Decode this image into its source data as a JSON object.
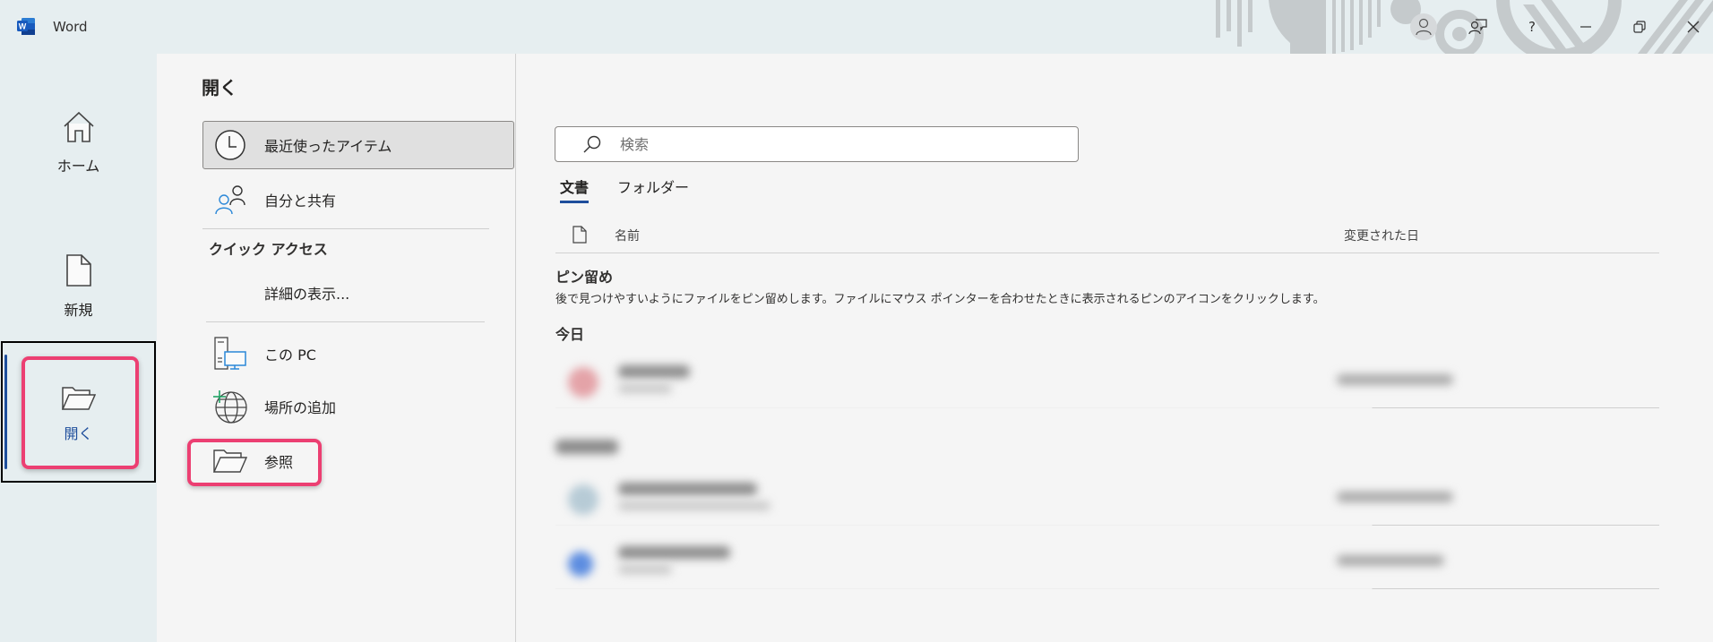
{
  "window": {
    "app_title": "Word",
    "controls": {
      "account": "account-icon",
      "feedback": "feedback-icon",
      "help": "?",
      "minimize": "minimize-icon",
      "restore": "restore-icon",
      "close": "close-icon"
    }
  },
  "leftnav": {
    "items": [
      {
        "label": "ホーム",
        "icon": "home-icon"
      },
      {
        "label": "新規",
        "icon": "new-document-icon"
      },
      {
        "label": "開く",
        "icon": "open-folder-icon",
        "active": true
      }
    ]
  },
  "open_page": {
    "title": "開く",
    "places": [
      {
        "label": "最近使ったアイテム",
        "icon": "clock-icon",
        "selected": true
      },
      {
        "label": "自分と共有",
        "icon": "shared-people-icon"
      }
    ],
    "quick_access": {
      "heading": "クイック アクセス",
      "more_label": "詳細の表示..."
    },
    "locations": [
      {
        "label": "この PC",
        "icon": "this-pc-icon"
      },
      {
        "label": "場所の追加",
        "icon": "add-place-globe-icon"
      },
      {
        "label": "参照",
        "icon": "browse-folder-icon"
      }
    ]
  },
  "content": {
    "search": {
      "placeholder": "検索",
      "value": ""
    },
    "tabs": [
      {
        "label": "文書",
        "active": true
      },
      {
        "label": "フォルダー",
        "active": false
      }
    ],
    "columns": {
      "name": "名前",
      "modified": "変更された日"
    },
    "pinned": {
      "title": "ピン留め",
      "description": "後で見つけやすいようにファイルをピン留めします。ファイルにマウス ポインターを合わせたときに表示されるピンのアイコンをクリックします。"
    },
    "groups": [
      {
        "title": "今日",
        "files": [
          {
            "blurred": true,
            "icon_color": "#e4a3a8"
          }
        ]
      },
      {
        "title": "",
        "title_blurred": true,
        "files": [
          {
            "blurred": true,
            "icon_color": "#b7cbd6"
          },
          {
            "blurred": true,
            "icon_color": "#5d8de0"
          }
        ]
      }
    ]
  },
  "annotations": {
    "highlight_color": "#ec3f72"
  },
  "colors": {
    "accent": "#1e4e9c",
    "titlebar_bg": "#e6eef0",
    "main_bg": "#f5f5f5"
  }
}
